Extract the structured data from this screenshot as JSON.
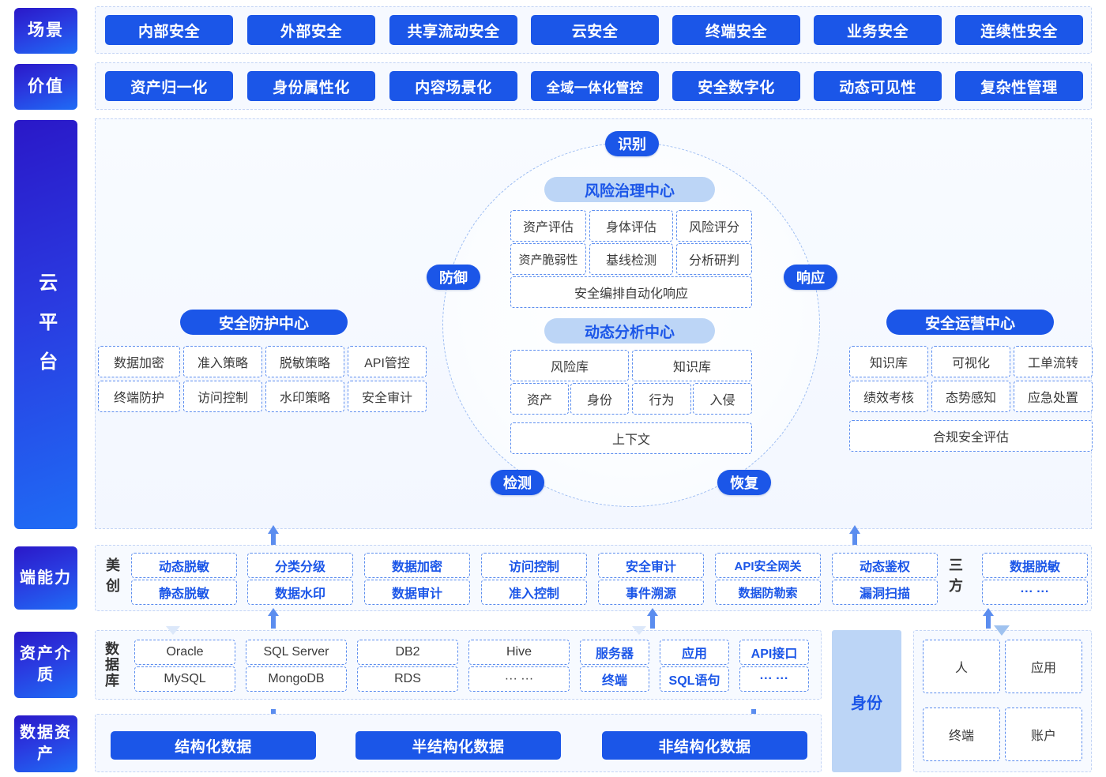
{
  "rows": {
    "scene": {
      "label": "场景",
      "items": [
        "内部安全",
        "外部安全",
        "共享流动安全",
        "云安全",
        "终端安全",
        "业务安全",
        "连续性安全"
      ]
    },
    "value": {
      "label": "价值",
      "items": [
        "资产归一化",
        "身份属性化",
        "内容场景化",
        "全域一体化管控",
        "安全数字化",
        "动态可见性",
        "复杂性管理"
      ]
    },
    "cloud": {
      "label": "云平台"
    },
    "endpoint": {
      "label": "端能力",
      "vendor_label": "美创",
      "thirdparty_label": "三方",
      "vendor_groups": [
        [
          "动态脱敏",
          "静态脱敏"
        ],
        [
          "分类分级",
          "数据水印"
        ],
        [
          "数据加密",
          "数据审计"
        ],
        [
          "访问控制",
          "准入控制"
        ],
        [
          "安全审计",
          "事件溯源"
        ],
        [
          "API安全网关",
          "数据防勒索"
        ],
        [
          "动态鉴权",
          "漏洞扫描"
        ]
      ],
      "thirdparty_group": [
        "数据脱敏",
        "··· ···"
      ]
    },
    "asset": {
      "label": "资产介质",
      "db_label": "数据库",
      "identity_label": "身份",
      "db_groups": [
        [
          "Oracle",
          "MySQL"
        ],
        [
          "SQL Server",
          "MongoDB"
        ],
        [
          "DB2",
          "RDS"
        ],
        [
          "Hive",
          "··· ···"
        ]
      ],
      "app_groups": [
        [
          "服务器",
          "终端"
        ],
        [
          "应用",
          "SQL语句"
        ],
        [
          "API接口",
          "··· ···"
        ]
      ],
      "identity_items": [
        "人",
        "应用",
        "终端",
        "账户"
      ]
    },
    "data": {
      "label": "数据资产",
      "items": [
        "结构化数据",
        "半结构化数据",
        "非结构化数据"
      ]
    }
  },
  "center": {
    "badges": {
      "identify": "识别",
      "defend": "防御",
      "respond": "响应",
      "detect": "检测",
      "recover": "恢复"
    },
    "risk_center": {
      "title": "风险治理中心",
      "row1": [
        "资产评估",
        "身体评估",
        "风险评分"
      ],
      "row2": [
        "资产脆弱性",
        "基线检测",
        "分析研判"
      ],
      "row3": "安全编排自动化响应"
    },
    "analysis_center": {
      "title": "动态分析中心",
      "row1": [
        "风险库",
        "知识库"
      ],
      "row2": [
        "资产",
        "身份",
        "行为",
        "入侵"
      ],
      "row3": "上下文"
    },
    "protection_center": {
      "title": "安全防护中心",
      "row1": [
        "数据加密",
        "准入策略",
        "脱敏策略",
        "API管控"
      ],
      "row2": [
        "终端防护",
        "访问控制",
        "水印策略",
        "安全审计"
      ]
    },
    "operation_center": {
      "title": "安全运营中心",
      "row1": [
        "知识库",
        "可视化",
        "工单流转"
      ],
      "row2": [
        "绩效考核",
        "态势感知",
        "应急处置"
      ],
      "row3": "合规安全评估"
    }
  },
  "colors": {
    "primary_blue": "#1b56e8",
    "sidebar_gradient_start": "#2a18c8",
    "sidebar_gradient_end": "#1f6cf5",
    "center_title_bg": "#bcd5f6",
    "dashed_border": "#5b8def",
    "band_bg": "#f6f9ff"
  }
}
